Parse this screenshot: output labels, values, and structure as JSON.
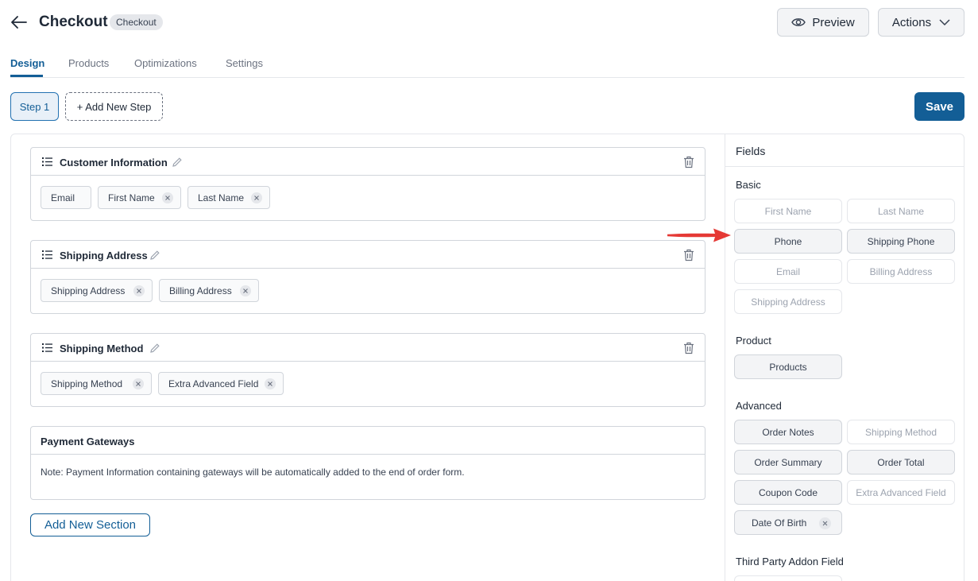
{
  "header": {
    "title": "Checkout",
    "badge": "Checkout",
    "preview_label": "Preview",
    "actions_label": "Actions"
  },
  "tabs": [
    {
      "label": "Design",
      "active": true
    },
    {
      "label": "Products",
      "active": false
    },
    {
      "label": "Optimizations",
      "active": false
    },
    {
      "label": "Settings",
      "active": false
    }
  ],
  "steps": {
    "current_label": "Step 1",
    "add_label": "+ Add New Step",
    "save_label": "Save"
  },
  "sections": [
    {
      "title": "Customer Information",
      "fields": [
        {
          "label": "Email",
          "removable": false
        },
        {
          "label": "First Name",
          "removable": true
        },
        {
          "label": "Last Name",
          "removable": true
        }
      ]
    },
    {
      "title": "Shipping Address",
      "fields": [
        {
          "label": "Shipping Address",
          "removable": true
        },
        {
          "label": "Billing Address",
          "removable": true
        }
      ]
    },
    {
      "title": "Shipping Method",
      "fields": [
        {
          "label": "Shipping Method",
          "removable": true
        },
        {
          "label": "Extra Advanced Field",
          "removable": true
        }
      ]
    }
  ],
  "payment": {
    "title": "Payment Gateways",
    "note": "Note: Payment Information containing gateways will be automatically added to the end of order form."
  },
  "add_section_label": "Add New Section",
  "fields_panel": {
    "title": "Fields",
    "groups": [
      {
        "label": "Basic",
        "items": [
          {
            "label": "First Name",
            "enabled": false
          },
          {
            "label": "Last Name",
            "enabled": false
          },
          {
            "label": "Phone",
            "enabled": true
          },
          {
            "label": "Shipping Phone",
            "enabled": true
          },
          {
            "label": "Email",
            "enabled": false
          },
          {
            "label": "Billing Address",
            "enabled": false
          },
          {
            "label": "Shipping Address",
            "enabled": false
          }
        ]
      },
      {
        "label": "Product",
        "items": [
          {
            "label": "Products",
            "enabled": true
          }
        ]
      },
      {
        "label": "Advanced",
        "items": [
          {
            "label": "Order Notes",
            "enabled": true
          },
          {
            "label": "Shipping Method",
            "enabled": false
          },
          {
            "label": "Order Summary",
            "enabled": true
          },
          {
            "label": "Order Total",
            "enabled": true
          },
          {
            "label": "Coupon Code",
            "enabled": true
          },
          {
            "label": "Extra Advanced Field",
            "enabled": false
          },
          {
            "label": "Date Of Birth",
            "enabled": true,
            "removable": true
          }
        ]
      },
      {
        "label": "Third Party Addon Field",
        "items": []
      }
    ]
  },
  "colors": {
    "accent": "#135e96",
    "arrow": "#e53935"
  }
}
